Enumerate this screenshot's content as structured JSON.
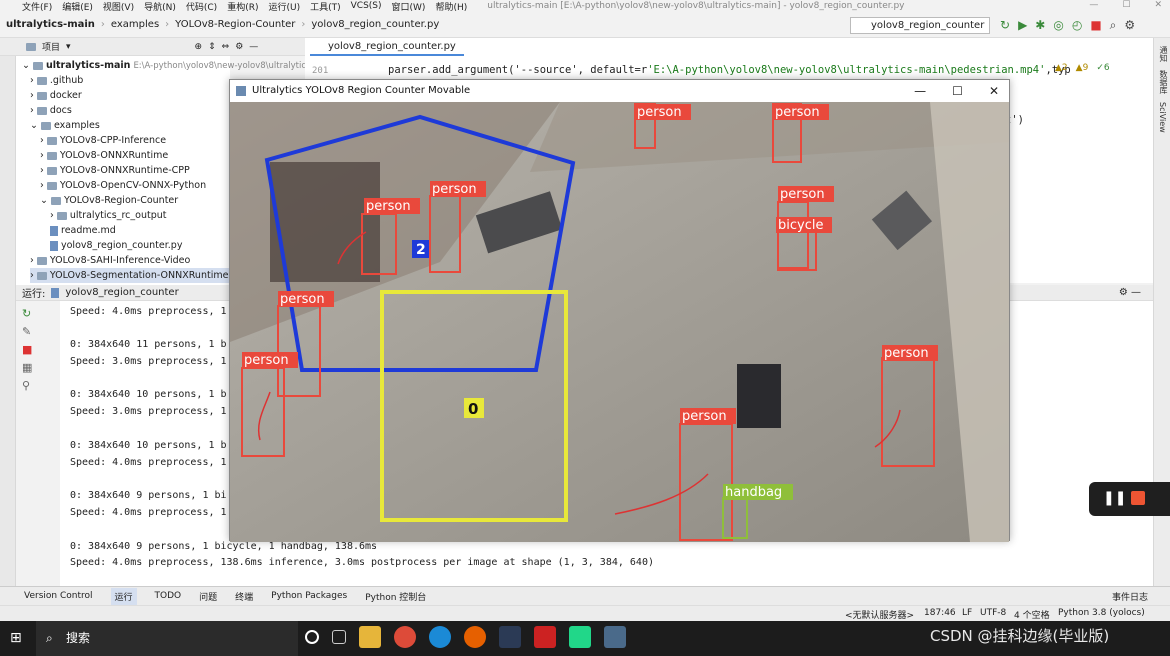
{
  "menubar": {
    "items": [
      "文件(F)",
      "编辑(E)",
      "视图(V)",
      "导航(N)",
      "代码(C)",
      "重构(R)",
      "运行(U)",
      "工具(T)",
      "VCS(S)",
      "窗口(W)",
      "帮助(H)"
    ],
    "title": "ultralytics-main [E:\\A-python\\yolov8\\new-yolov8\\ultralytics-main] - yolov8_region_counter.py"
  },
  "navbar": {
    "crumbs": [
      "ultralytics-main",
      "examples",
      "YOLOv8-Region-Counter",
      "yolov8_region_counter.py"
    ],
    "run_config": "yolov8_region_counter"
  },
  "project": {
    "header": "项目",
    "root_label": "ultralytics-main",
    "root_path": "E:\\A-python\\yolov8\\new-yolov8\\ultralytic",
    "items": [
      ".github",
      "docker",
      "docs",
      "examples",
      "YOLOv8-CPP-Inference",
      "YOLOv8-ONNXRuntime",
      "YOLOv8-ONNXRuntime-CPP",
      "YOLOv8-OpenCV-ONNX-Python",
      "YOLOv8-Region-Counter",
      "ultralytics_rc_output",
      "readme.md",
      "yolov8_region_counter.py",
      "YOLOv8-SAHI-Inference-Video",
      "YOLOv8-Segmentation-ONNXRuntime"
    ]
  },
  "editor": {
    "tab": "yolov8_region_counter.py",
    "line_no": "201",
    "code_pre": "parser.add_argument('--source', default=r",
    "code_str": "'E:\\A-python\\yolov8\\new-yolov8\\ultralytics-main\\pedestrian.mp4'",
    "code_post": ",typ",
    "code2": "t')",
    "warnings": [
      "▲2",
      "▲9",
      "✓6"
    ]
  },
  "right_strip": [
    "通知",
    "数据库",
    "SciView"
  ],
  "run": {
    "label": "运行:",
    "config": "yolov8_region_counter",
    "lines": [
      "Speed: 4.0ms preprocess, 1",
      "0: 384x640 11 persons, 1 b",
      "Speed: 3.0ms preprocess, 1",
      "0: 384x640 10 persons, 1 b",
      "Speed: 3.0ms preprocess, 1",
      "0: 384x640 10 persons, 1 b",
      "Speed: 4.0ms preprocess, 1",
      "0: 384x640 9 persons, 1 bi",
      "Speed: 4.0ms preprocess, 1",
      "0: 384x640 9 persons, 1 bicycle, 1 handbag, 138.6ms",
      "Speed: 4.0ms preprocess, 138.6ms inference, 3.0ms postprocess per image at shape (1, 3, 384, 640)"
    ]
  },
  "bottom_tabs": [
    "Version Control",
    "运行",
    "TODO",
    "问题",
    "终端",
    "Python Packages",
    "Python 控制台"
  ],
  "bottom_right": "事件日志",
  "status": {
    "server": "<无默认服务器>",
    "pos": "187:46",
    "le": "LF",
    "enc": "UTF-8",
    "indent": "4 个空格",
    "interp": "Python 3.8 (yolocs)"
  },
  "taskbar": {
    "search": "搜索",
    "watermark": "CSDN @挂科边缘(毕业版)"
  },
  "cv_window": {
    "title": "Ultralytics YOLOv8 Region Counter Movable",
    "region_counts": [
      "2",
      "0"
    ],
    "labels": [
      "person",
      "person",
      "person",
      "person",
      "person",
      "bicycle",
      "person",
      "person",
      "person",
      "person",
      "handbag"
    ]
  },
  "colors": {
    "accent": "#4a88d9",
    "region_blue": "#1e3ad8",
    "region_yellow": "#e8e83a",
    "box_red": "#e9493c"
  }
}
